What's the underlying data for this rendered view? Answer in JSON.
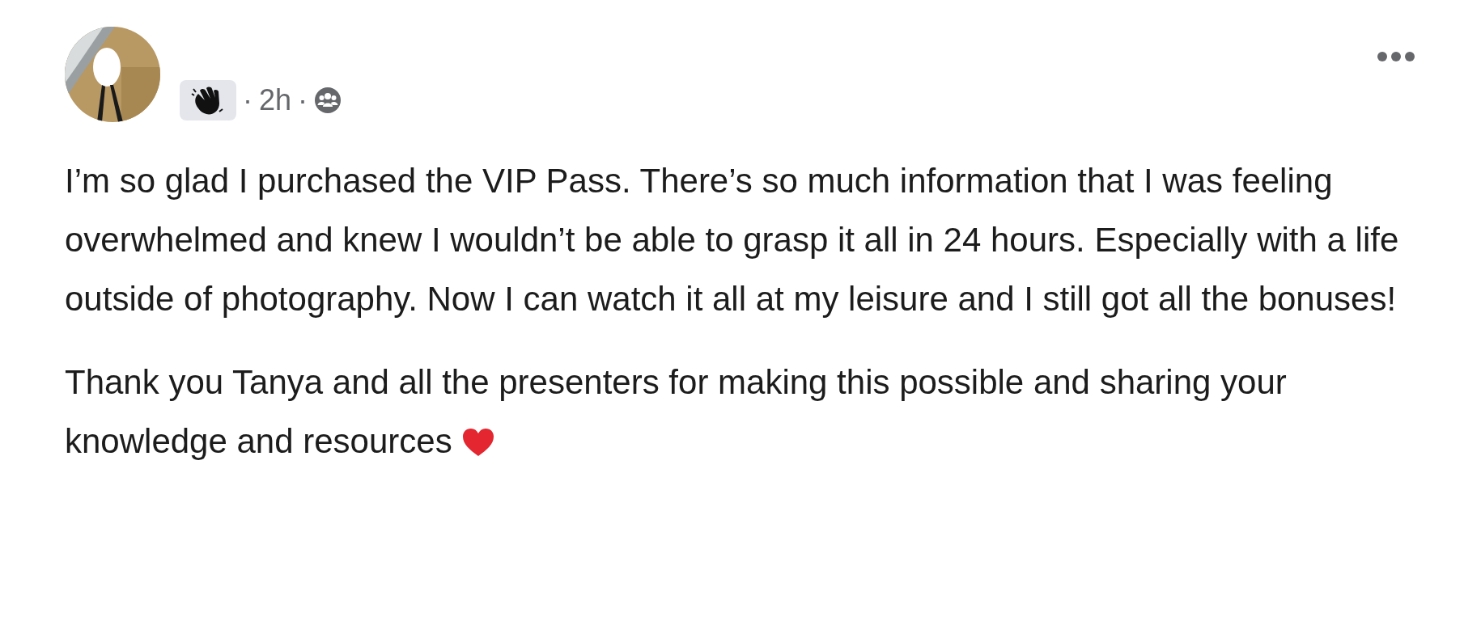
{
  "post": {
    "badge": {
      "kind": "wave"
    },
    "time": "2h",
    "separator": "·",
    "audience": {
      "kind": "group"
    },
    "paragraphs": [
      "I’m so glad I purchased the VIP Pass. There’s so much information that I was feeling overwhelmed and knew I wouldn’t be able to grasp it all in 24 hours. Especially with a life outside of photography. Now I can watch it all at my leisure and I still got all the bonuses!",
      "Thank you Tanya and all the presenters for making this possible and sharing your knowledge and resources"
    ],
    "trailing_emoji": {
      "kind": "heart"
    }
  }
}
